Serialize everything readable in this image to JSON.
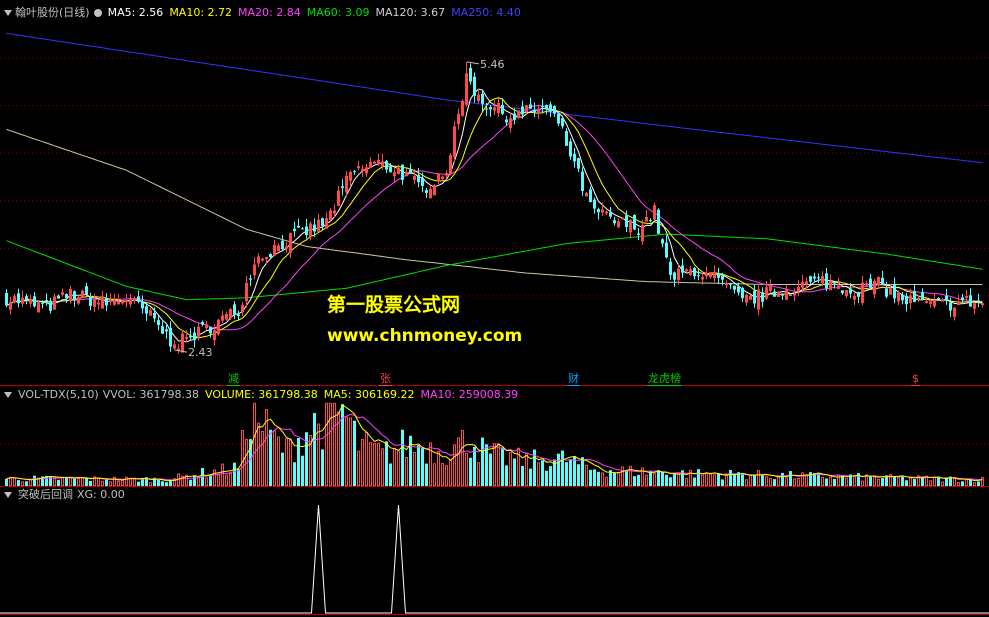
{
  "main_legend": {
    "title": "翰叶股份(日线)",
    "ma5": "MA5: 2.56",
    "ma10": "MA10: 2.72",
    "ma20": "MA20: 2.84",
    "ma60": "MA60: 3.09",
    "ma120": "MA120: 3.67",
    "ma250": "MA250: 4.40"
  },
  "vol_legend": {
    "title": "VOL-TDX(5,10)",
    "vvol": "VVOL: 361798.38",
    "volume": "VOLUME: 361798.38",
    "ma5": "MA5: 306169.22",
    "ma10": "MA10: 259008.39"
  },
  "xg_legend": {
    "title": "突破后回调",
    "xg": "XG: 0.00"
  },
  "watermark": {
    "line1": "第一股票公式网",
    "line2": "www.chnmoney.com"
  },
  "event_markers": [
    {
      "label": "减",
      "color": "#00cc00",
      "index": 56
    },
    {
      "label": "张",
      "color": "#ff3b3b",
      "index": 94
    },
    {
      "label": "财",
      "color": "#00a0ff",
      "index": 141
    },
    {
      "label": "龙虎榜",
      "color": "#00cc00",
      "index": 161
    },
    {
      "label": "$",
      "color": "#ff3b3b",
      "index": 227
    }
  ],
  "annotations": {
    "low": "2.43",
    "high": "5.46"
  },
  "colors": {
    "up": "#ff4a4a",
    "down": "#54ffff",
    "ma5": "#ffffff",
    "ma10": "#ffff00",
    "ma20": "#ff40ff",
    "ma60": "#00dd00",
    "ma120": "#c8c8a0",
    "ma250": "#3333ff",
    "grid": "#8b0000",
    "label": "#c0c0c0"
  },
  "chart_data": {
    "type": "candlestick",
    "x": "trading days (indices 0–244)",
    "price_ylim": [
      2.2,
      5.9
    ],
    "volume_ylim": [
      0,
      1000000
    ],
    "xg_ylim": [
      0,
      1
    ],
    "low": {
      "index": 42,
      "value": 2.43
    },
    "high": {
      "index": 115,
      "value": 5.46
    },
    "price_path": [
      [
        0,
        2.98
      ],
      [
        10,
        2.88
      ],
      [
        16,
        3.02
      ],
      [
        25,
        2.92
      ],
      [
        30,
        2.98
      ],
      [
        36,
        2.78
      ],
      [
        42,
        2.48
      ],
      [
        50,
        2.66
      ],
      [
        58,
        2.85
      ],
      [
        62,
        3.38
      ],
      [
        70,
        3.58
      ],
      [
        80,
        3.78
      ],
      [
        86,
        4.28
      ],
      [
        92,
        4.4
      ],
      [
        98,
        4.32
      ],
      [
        104,
        4.12
      ],
      [
        110,
        4.34
      ],
      [
        115,
        5.25
      ],
      [
        120,
        5.02
      ],
      [
        126,
        4.88
      ],
      [
        134,
        4.98
      ],
      [
        138,
        4.82
      ],
      [
        142,
        4.38
      ],
      [
        146,
        3.92
      ],
      [
        152,
        3.78
      ],
      [
        158,
        3.72
      ],
      [
        162,
        3.88
      ],
      [
        166,
        3.18
      ],
      [
        172,
        3.28
      ],
      [
        178,
        3.16
      ],
      [
        184,
        2.94
      ],
      [
        190,
        3.02
      ],
      [
        196,
        3.08
      ],
      [
        204,
        3.16
      ],
      [
        212,
        3.06
      ],
      [
        218,
        3.12
      ],
      [
        224,
        2.96
      ],
      [
        232,
        2.9
      ],
      [
        240,
        2.94
      ],
      [
        244,
        2.92
      ]
    ],
    "ma_last": {
      "MA5": 2.56,
      "MA10": 2.72,
      "MA20": 2.84,
      "MA60": 3.09,
      "MA120": 3.67,
      "MA250": 4.4
    },
    "ma250_path": [
      [
        0,
        5.76
      ],
      [
        110,
        5.06
      ],
      [
        170,
        4.76
      ],
      [
        244,
        4.4
      ]
    ],
    "ma120_path": [
      [
        0,
        4.75
      ],
      [
        30,
        4.32
      ],
      [
        60,
        3.7
      ],
      [
        75,
        3.52
      ],
      [
        100,
        3.38
      ],
      [
        130,
        3.24
      ],
      [
        160,
        3.15
      ],
      [
        190,
        3.12
      ],
      [
        244,
        3.12
      ]
    ],
    "ma60_path": [
      [
        0,
        3.58
      ],
      [
        30,
        3.1
      ],
      [
        45,
        2.96
      ],
      [
        60,
        2.98
      ],
      [
        85,
        3.08
      ],
      [
        110,
        3.32
      ],
      [
        140,
        3.55
      ],
      [
        165,
        3.65
      ],
      [
        190,
        3.6
      ],
      [
        220,
        3.44
      ],
      [
        244,
        3.28
      ]
    ],
    "volume_base": [
      [
        0,
        90000
      ],
      [
        40,
        80000
      ],
      [
        50,
        160000
      ],
      [
        58,
        220000
      ],
      [
        61,
        950000
      ],
      [
        66,
        600000
      ],
      [
        70,
        420000
      ],
      [
        76,
        700000
      ],
      [
        84,
        900000
      ],
      [
        88,
        500000
      ],
      [
        94,
        380000
      ],
      [
        100,
        500000
      ],
      [
        110,
        420000
      ],
      [
        116,
        560000
      ],
      [
        120,
        380000
      ],
      [
        130,
        300000
      ],
      [
        140,
        320000
      ],
      [
        146,
        200000
      ],
      [
        160,
        170000
      ],
      [
        170,
        150000
      ],
      [
        200,
        120000
      ],
      [
        230,
        90000
      ],
      [
        244,
        80000
      ]
    ],
    "xg_spikes": [
      78,
      98
    ]
  }
}
